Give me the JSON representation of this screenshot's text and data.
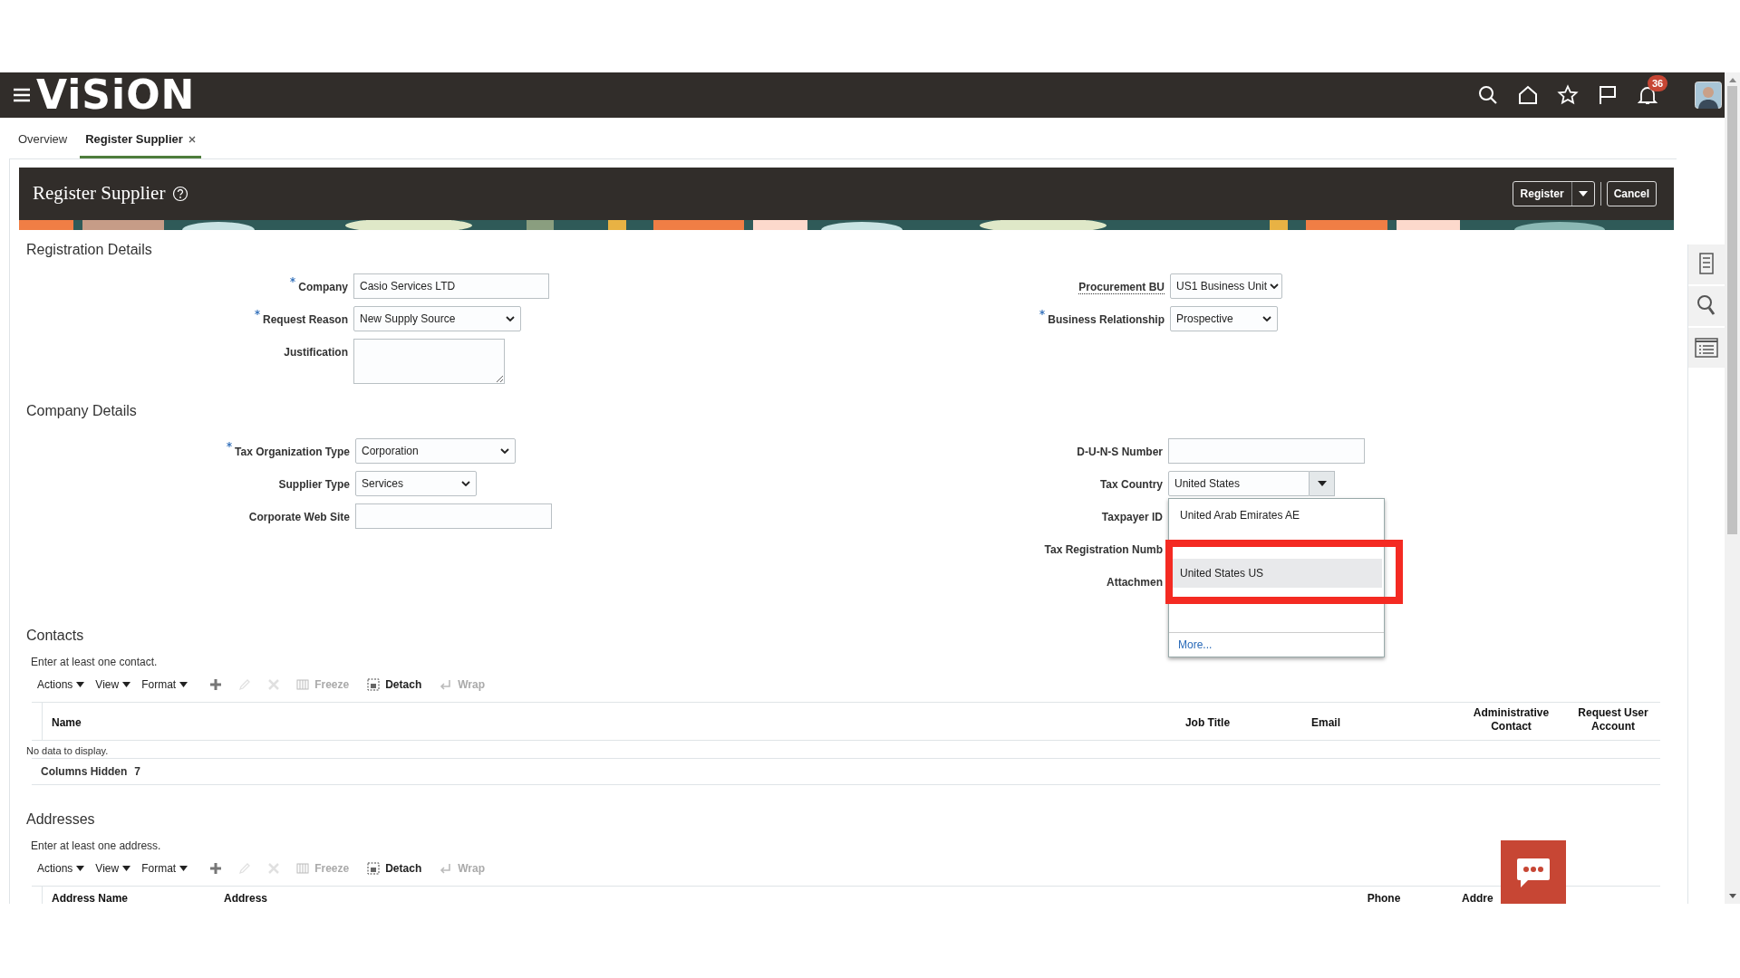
{
  "app_bar": {
    "logo": "ViSiON",
    "notifications": "36"
  },
  "tabs": [
    {
      "label": "Overview",
      "selected": false,
      "closable": false
    },
    {
      "label": "Register Supplier",
      "selected": true,
      "closable": true
    }
  ],
  "page": {
    "title": "Register Supplier",
    "buttons": [
      {
        "label": "Register",
        "kind": "split"
      },
      {
        "label": "Cancel",
        "kind": "plain"
      }
    ]
  },
  "sections": [
    {
      "title": "Registration Details",
      "left": [
        {
          "label": "Company",
          "required": true,
          "kind": "text",
          "value": "Casio Services LTD"
        },
        {
          "label": "Request Reason",
          "required": true,
          "kind": "select",
          "value": "New Supply Source"
        },
        {
          "label": "Justification",
          "required": false,
          "kind": "textarea"
        }
      ],
      "right": [
        {
          "label": "Procurement BU",
          "required": false,
          "underlined": true,
          "kind": "select",
          "value": "US1 Business Unit"
        },
        {
          "label": "Business Relationship",
          "required": true,
          "underlined": false,
          "kind": "select",
          "value": "Prospective"
        }
      ]
    },
    {
      "title": "Company Details",
      "left": [
        {
          "label": "Tax Organization Type",
          "required": true,
          "kind": "select",
          "value": "Corporation"
        },
        {
          "label": "Supplier Type",
          "required": false,
          "kind": "select",
          "value": "Services"
        },
        {
          "label": "Corporate Web Site",
          "required": false,
          "kind": "text"
        }
      ],
      "right": [
        {
          "label": "D-U-N-S Number",
          "required": false,
          "underlined": false,
          "kind": "text"
        },
        {
          "label": "Tax Country",
          "required": false,
          "underlined": false,
          "kind": "combo",
          "value": "United States",
          "expanded": true
        },
        {
          "label": "Taxpayer ID",
          "required": false,
          "underlined": false,
          "kind": "label"
        },
        {
          "label": "Tax Registration Numb",
          "required": false,
          "underlined": false,
          "kind": "label"
        },
        {
          "label": "Attachmen",
          "required": false,
          "underlined": false,
          "kind": "label"
        }
      ]
    }
  ],
  "tax_country_list": {
    "options": [
      {
        "label": "United Arab Emirates AE",
        "selected": false
      },
      {
        "label": "United States US",
        "selected": true
      }
    ],
    "more": "More..."
  },
  "tables": [
    {
      "title": "Contacts",
      "instruction": "Enter at least one contact.",
      "columns": [
        "Name",
        "Job Title",
        "Email",
        "Administrative Contact",
        "Request User Account"
      ],
      "empty_text": "No data to display.",
      "hidden_label": "Columns Hidden",
      "hidden_count": "7",
      "toolbar": [
        {
          "kind": "menu",
          "label": "Actions",
          "disabled": false
        },
        {
          "kind": "menu",
          "label": "View",
          "disabled": false
        },
        {
          "kind": "menu",
          "label": "Format",
          "disabled": false
        },
        {
          "kind": "add",
          "disabled": false
        },
        {
          "kind": "edit",
          "disabled": true
        },
        {
          "kind": "delete",
          "disabled": true
        },
        {
          "kind": "freeze",
          "label": "Freeze",
          "disabled": true
        },
        {
          "kind": "detach",
          "label": "Detach",
          "disabled": false
        },
        {
          "kind": "wrap",
          "label": "Wrap",
          "disabled": true
        }
      ]
    },
    {
      "title": "Addresses",
      "instruction": "Enter at least one address.",
      "columns": [
        "Address Name",
        "Address",
        "Phone",
        "Addre"
      ],
      "toolbar": [
        {
          "kind": "menu",
          "label": "Actions",
          "disabled": false
        },
        {
          "kind": "menu",
          "label": "View",
          "disabled": false
        },
        {
          "kind": "menu",
          "label": "Format",
          "disabled": false
        },
        {
          "kind": "add",
          "disabled": false
        },
        {
          "kind": "edit",
          "disabled": true
        },
        {
          "kind": "delete",
          "disabled": true
        },
        {
          "kind": "freeze",
          "label": "Freeze",
          "disabled": true
        },
        {
          "kind": "detach",
          "label": "Detach",
          "disabled": false
        },
        {
          "kind": "wrap",
          "label": "Wrap",
          "disabled": true
        }
      ]
    }
  ]
}
